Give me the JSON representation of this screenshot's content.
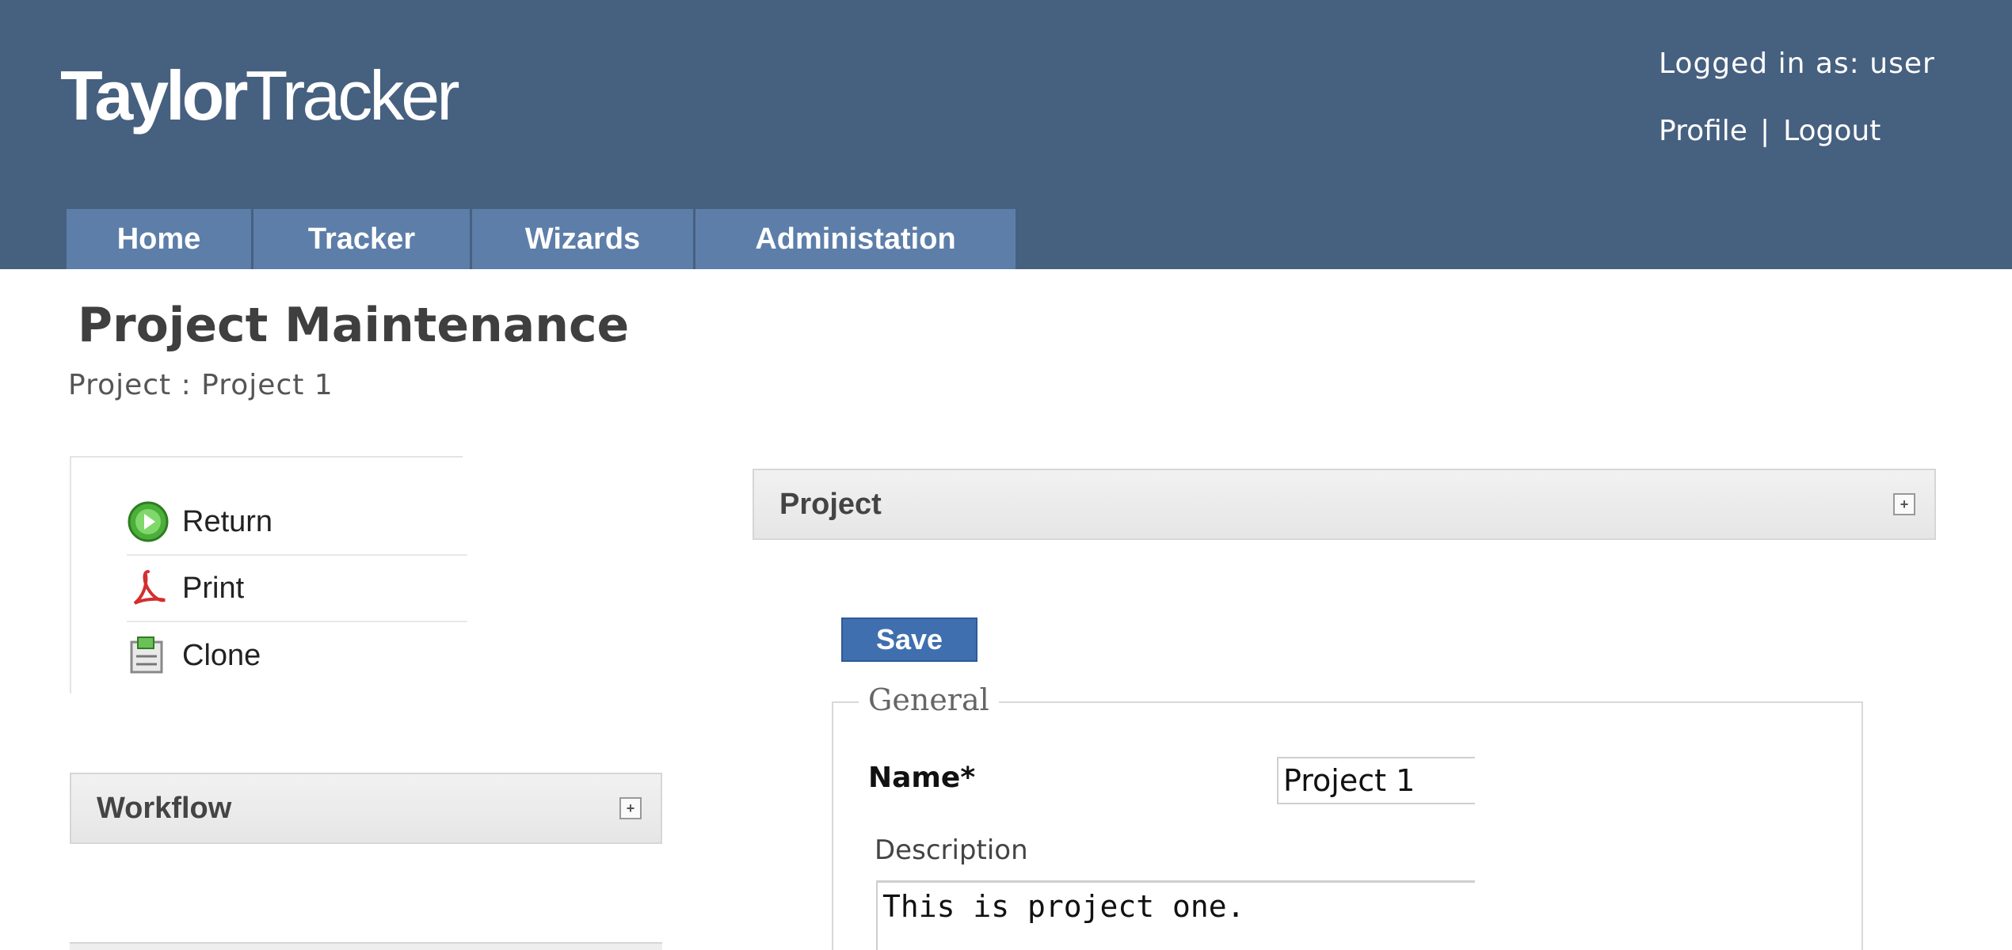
{
  "app": {
    "logo_part1": "Taylor",
    "logo_part2": "Tracker"
  },
  "user": {
    "logged_in_text": "Logged in as: user",
    "profile_label": "Profile",
    "separator": "|",
    "logout_label": "Logout"
  },
  "nav": {
    "tabs": [
      {
        "label": "Home"
      },
      {
        "label": "Tracker"
      },
      {
        "label": "Wizards"
      },
      {
        "label": "Administation"
      }
    ]
  },
  "page": {
    "title": "Project Maintenance",
    "breadcrumb": "Project : Project 1"
  },
  "actions": [
    {
      "label": "Return",
      "icon": "return-icon"
    },
    {
      "label": "Print",
      "icon": "pdf-icon"
    },
    {
      "label": "Clone",
      "icon": "clone-icon"
    }
  ],
  "panels": {
    "workflow_title": "Workflow",
    "project_title": "Project",
    "toggle_glyph": "+"
  },
  "form": {
    "save_label": "Save",
    "legend": "General",
    "name_label": "Name*",
    "name_value": "Project 1",
    "description_label": "Description",
    "description_value": "This is project one."
  },
  "colors": {
    "header_bg": "#46607f",
    "tab_bg": "#5d7ea9",
    "save_bg": "#3f6fae"
  }
}
